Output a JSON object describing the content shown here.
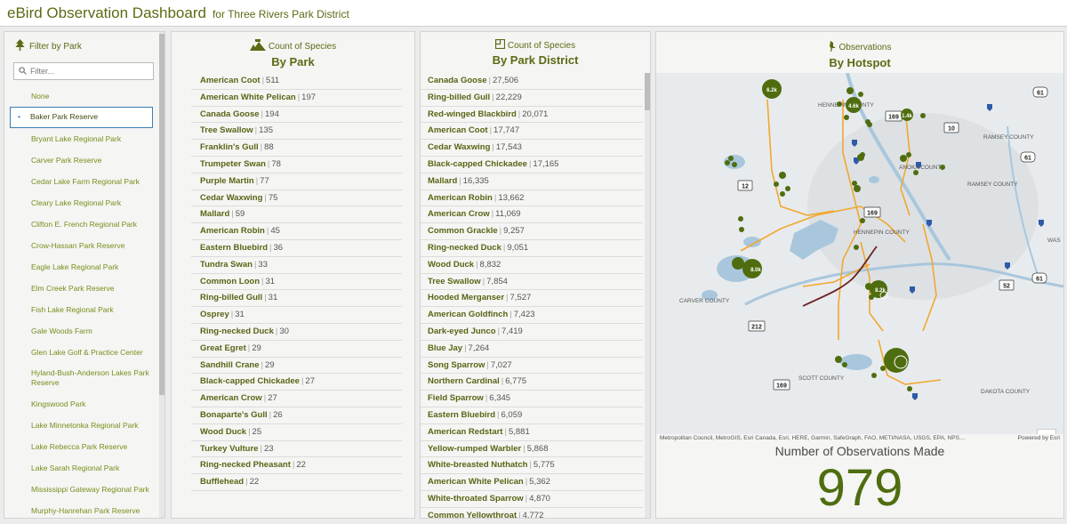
{
  "header": {
    "title": "eBird Observation Dashboard",
    "subtitle": "for Three Rivers Park District"
  },
  "filter": {
    "title": "Filter by Park",
    "search_placeholder": "Filter...",
    "items": [
      {
        "label": "None"
      },
      {
        "label": "Baker Park Reserve",
        "selected": true
      },
      {
        "label": "Bryant Lake Regional Park"
      },
      {
        "label": "Carver Park Reserve"
      },
      {
        "label": "Cedar Lake Farm Regional Park"
      },
      {
        "label": "Cleary Lake Regional Park"
      },
      {
        "label": "Clifton E. French Regional Park"
      },
      {
        "label": "Crow-Hassan Park Reserve"
      },
      {
        "label": "Eagle Lake Regional Park"
      },
      {
        "label": "Elm Creek Park Reserve"
      },
      {
        "label": "Fish Lake Regional Park"
      },
      {
        "label": "Gale Woods Farm"
      },
      {
        "label": "Glen Lake Golf & Practice Center"
      },
      {
        "label": "Hyland-Bush-Anderson Lakes Park Reserve",
        "two_line": true
      },
      {
        "label": "Kingswood Park"
      },
      {
        "label": "Lake Minnetonka Regional Park"
      },
      {
        "label": "Lake Rebecca Park Reserve"
      },
      {
        "label": "Lake Sarah Regional Park"
      },
      {
        "label": "Mississippi Gateway Regional Park"
      },
      {
        "label": "Murphy-Hanrehan Park Reserve"
      }
    ]
  },
  "by_park": {
    "caption": "Count of Species",
    "title": "By Park",
    "rows": [
      {
        "name": "American Coot",
        "count": "511"
      },
      {
        "name": "American White Pelican",
        "count": "197"
      },
      {
        "name": "Canada Goose",
        "count": "194"
      },
      {
        "name": "Tree Swallow",
        "count": "135"
      },
      {
        "name": "Franklin's Gull",
        "count": "88"
      },
      {
        "name": "Trumpeter Swan",
        "count": "78"
      },
      {
        "name": "Purple Martin",
        "count": "77"
      },
      {
        "name": "Cedar Waxwing",
        "count": "75"
      },
      {
        "name": "Mallard",
        "count": "59"
      },
      {
        "name": "American Robin",
        "count": "45"
      },
      {
        "name": "Eastern Bluebird",
        "count": "36"
      },
      {
        "name": "Tundra Swan",
        "count": "33"
      },
      {
        "name": "Common Loon",
        "count": "31"
      },
      {
        "name": "Ring-billed Gull",
        "count": "31"
      },
      {
        "name": "Osprey",
        "count": "31"
      },
      {
        "name": "Ring-necked Duck",
        "count": "30"
      },
      {
        "name": "Great Egret",
        "count": "29"
      },
      {
        "name": "Sandhill Crane",
        "count": "29"
      },
      {
        "name": "Black-capped Chickadee",
        "count": "27"
      },
      {
        "name": "American Crow",
        "count": "27"
      },
      {
        "name": "Bonaparte's Gull",
        "count": "26"
      },
      {
        "name": "Wood Duck",
        "count": "25"
      },
      {
        "name": "Turkey Vulture",
        "count": "23"
      },
      {
        "name": "Ring-necked Pheasant",
        "count": "22"
      },
      {
        "name": "Bufflehead",
        "count": "22"
      }
    ]
  },
  "by_district": {
    "caption": "Count of Species",
    "title": "By Park District",
    "rows": [
      {
        "name": "Canada Goose",
        "count": "27,506"
      },
      {
        "name": "Ring-billed Gull",
        "count": "22,229"
      },
      {
        "name": "Red-winged Blackbird",
        "count": "20,071"
      },
      {
        "name": "American Coot",
        "count": "17,747"
      },
      {
        "name": "Cedar Waxwing",
        "count": "17,543"
      },
      {
        "name": "Black-capped Chickadee",
        "count": "17,165"
      },
      {
        "name": "Mallard",
        "count": "16,335"
      },
      {
        "name": "American Robin",
        "count": "13,662"
      },
      {
        "name": "American Crow",
        "count": "11,069"
      },
      {
        "name": "Common Grackle",
        "count": "9,257"
      },
      {
        "name": "Ring-necked Duck",
        "count": "9,051"
      },
      {
        "name": "Wood Duck",
        "count": "8,832"
      },
      {
        "name": "Tree Swallow",
        "count": "7,854"
      },
      {
        "name": "Hooded Merganser",
        "count": "7,527"
      },
      {
        "name": "American Goldfinch",
        "count": "7,423"
      },
      {
        "name": "Dark-eyed Junco",
        "count": "7,419"
      },
      {
        "name": "Blue Jay",
        "count": "7,264"
      },
      {
        "name": "Song Sparrow",
        "count": "7,027"
      },
      {
        "name": "Northern Cardinal",
        "count": "6,775"
      },
      {
        "name": "Field Sparrow",
        "count": "6,345"
      },
      {
        "name": "Eastern Bluebird",
        "count": "6,059"
      },
      {
        "name": "American Redstart",
        "count": "5,881"
      },
      {
        "name": "Yellow-rumped Warbler",
        "count": "5,868"
      },
      {
        "name": "White-breasted Nuthatch",
        "count": "5,775"
      },
      {
        "name": "American White Pelican",
        "count": "5,362"
      },
      {
        "name": "White-throated Sparrow",
        "count": "4,870"
      },
      {
        "name": "Common Yellowthroat",
        "count": "4,772"
      }
    ]
  },
  "map": {
    "caption": "Observations",
    "title": "By Hotspot",
    "labels": {
      "hennepin_n": "HENNEPIN COUNTY",
      "hennepin_c": "HENNEPIN COUNTY",
      "anoka": "ANOKA COUNTY",
      "ramsey1": "RAMSEY COUNTY",
      "ramsey2": "RAMSEY COUNTY",
      "carver": "CARVER COUNTY",
      "scott": "SCOTT COUNTY",
      "dakota": "DAKOTA COUNTY",
      "was": "WAS"
    },
    "shields": [
      "61",
      "10",
      "61",
      "12",
      "169",
      "52",
      "61",
      "212",
      "169",
      "169",
      "10"
    ],
    "clusters": [
      "6.2k",
      "4.6k",
      "1.4k",
      "8.0k",
      "8.2k"
    ],
    "attribution": "Metropolitan Council, MetroGIS, Esri Canada, Esri, HERE, Garmin, SafeGraph, FAO, METI/NASA, USGS, EPA, NPS…",
    "powered_by": "Powered by Esri",
    "zoom_in": "+",
    "zoom_out": "−"
  },
  "observations": {
    "title": "Number of Observations Made",
    "value": "979"
  },
  "colors": {
    "accent": "#5a6b14",
    "marker": "#4f6d0f",
    "selection": "#3a7fb7",
    "water": "#a9c7dc",
    "road": "#f0a830",
    "route": "#6b1f1f"
  }
}
